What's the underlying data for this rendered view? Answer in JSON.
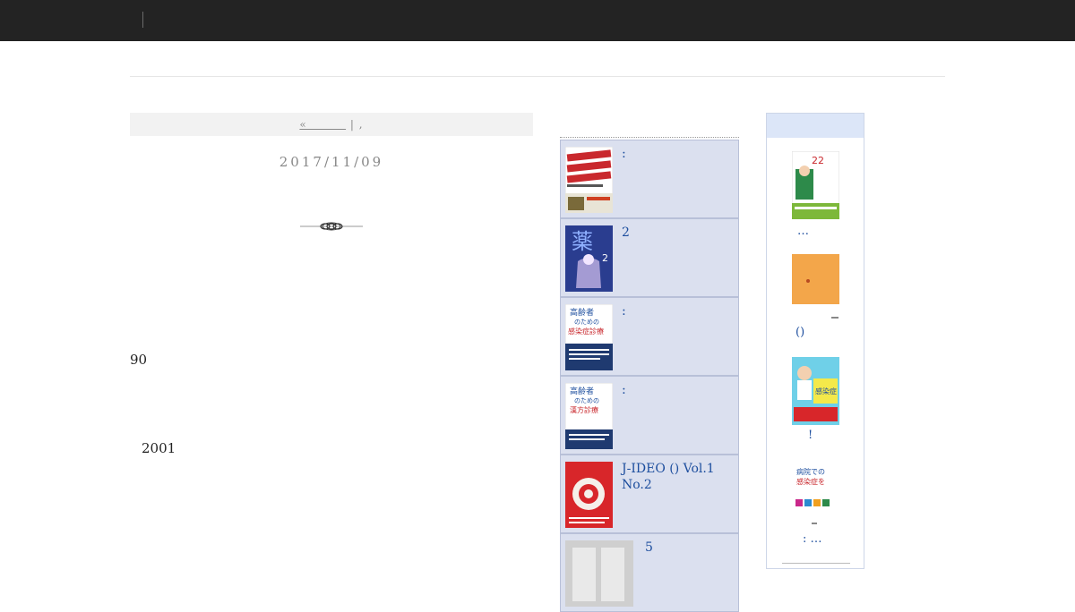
{
  "pager": {
    "prev_label": "«         ",
    "separator": " | ,"
  },
  "post": {
    "date": "2017/11/09",
    "paragraph_1": "90",
    "paragraph_2": "2001"
  },
  "ranking": {
    "title": "",
    "items": [
      {
        "title": ":",
        "cover_color": "#ffffff"
      },
      {
        "title": "2",
        "cover_color": "#2a3d8f"
      },
      {
        "title": ":",
        "cover_color": "#ffffff"
      },
      {
        "title": ":",
        "cover_color": "#ffffff"
      },
      {
        "title": "J-IDEO () Vol.1 No.2",
        "cover_color": "#d8262a"
      },
      {
        "title": "5",
        "cover_color": "#cfcfcf"
      }
    ]
  },
  "right_sidebar": {
    "books": [
      {
        "caption": "…",
        "cover_text": "22"
      },
      {
        "caption": "()",
        "cover_text": ""
      },
      {
        "caption": "!",
        "cover_text": ""
      },
      {
        "caption": ": …",
        "cover_text": ""
      }
    ]
  },
  "colors": {
    "topbar": "#232323",
    "rank_bg": "#dbe0ef",
    "link": "#1d4e9e",
    "right_head": "#dce6f8"
  }
}
